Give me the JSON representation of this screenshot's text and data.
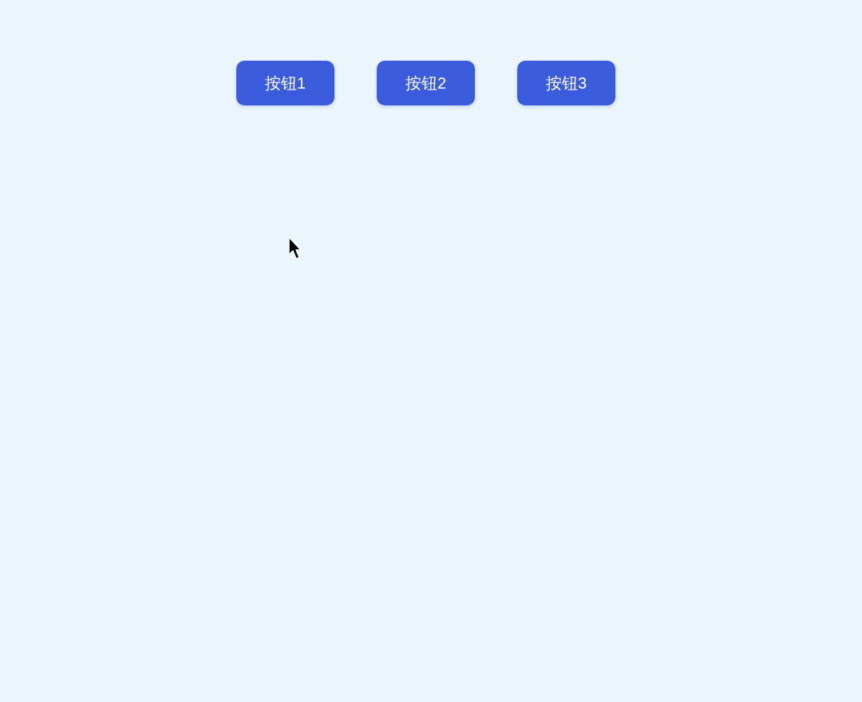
{
  "buttons": [
    {
      "label": "按钮1"
    },
    {
      "label": "按钮2"
    },
    {
      "label": "按钮3"
    }
  ]
}
